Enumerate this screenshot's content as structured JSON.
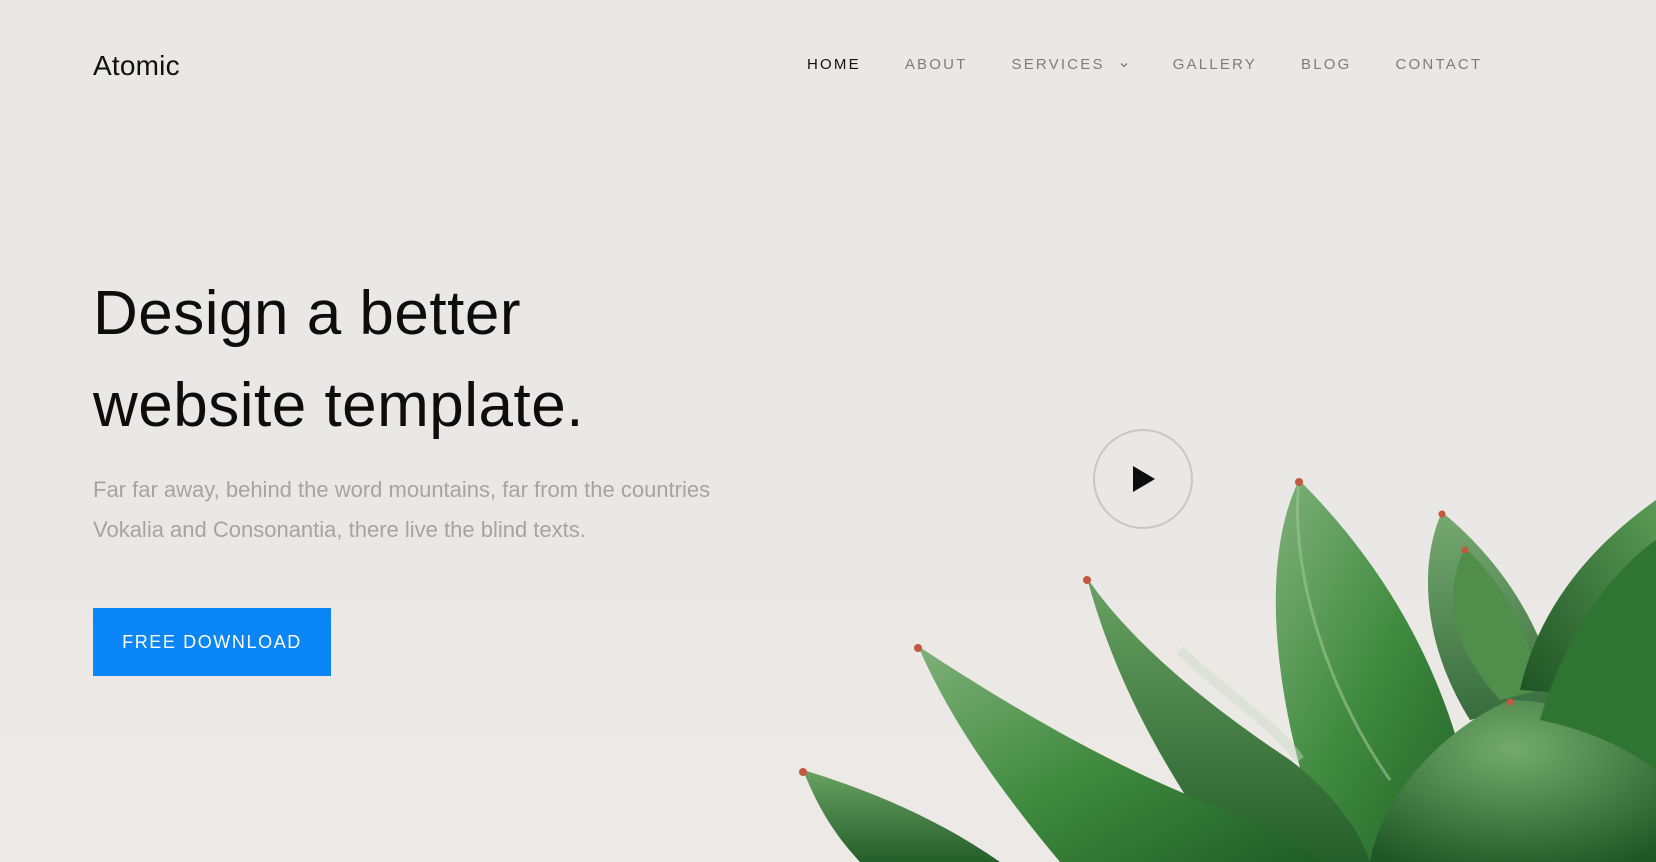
{
  "brand": {
    "logo": "Atomic"
  },
  "nav": {
    "items": [
      {
        "label": "HOME",
        "active": true
      },
      {
        "label": "ABOUT",
        "active": false
      },
      {
        "label": "SERVICES",
        "active": false,
        "has_dropdown": true
      },
      {
        "label": "GALLERY",
        "active": false
      },
      {
        "label": "BLOG",
        "active": false
      },
      {
        "label": "CONTACT",
        "active": false
      }
    ]
  },
  "hero": {
    "title_line1": "Design a better",
    "title_line2": "website template.",
    "subtitle_line1": "Far far away, behind the word mountains, far from the countries",
    "subtitle_line2": "Vokalia and Consonantia, there live the blind texts.",
    "cta_label": "FREE DOWNLOAD",
    "play_icon": "play-icon"
  },
  "colors": {
    "accent": "#0b86f8",
    "background": "#e9e8e6",
    "text_dark": "#0d0d0d",
    "text_muted": "#a4a4a4",
    "nav_muted": "#7d7d7d",
    "plant_green": "#3f8a3e"
  }
}
